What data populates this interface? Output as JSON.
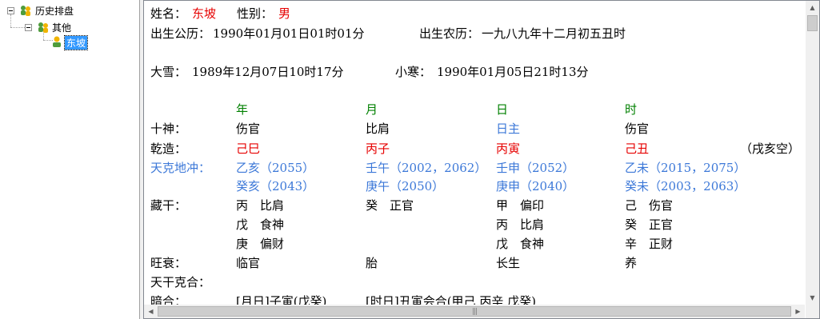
{
  "tree": {
    "root_label": "历史排盘",
    "group_label": "其他",
    "leaf_label": "东坡"
  },
  "profile": {
    "name_label": "姓名：",
    "name_value": "东坡",
    "gender_label": "性别：",
    "gender_value": "男",
    "solar_label": "出生公历：",
    "solar_value": "1990年01月01日01时01分",
    "lunar_label": "出生农历：",
    "lunar_value": "一九八九年十二月初五丑时",
    "term1_label": "大雪：",
    "term1_value": "1989年12月07日10时17分",
    "term2_label": "小寒：",
    "term2_value": "1990年01月05日21时13分"
  },
  "chart": {
    "columns": [
      "年",
      "月",
      "日",
      "时"
    ],
    "shishen_label": "十神：",
    "shishen": [
      "伤官",
      "比肩",
      "日主",
      "伤官"
    ],
    "qianzao_label": "乾造：",
    "qianzao": [
      "己巳",
      "丙子",
      "丙寅",
      "己丑"
    ],
    "kongwang": "（戌亥空）",
    "tiankedichong_label": "天克地冲：",
    "tkdc_row1": [
      "乙亥（2055）",
      "壬午（2002，2062）",
      "壬申（2052）",
      "乙未（2015，2075）"
    ],
    "tkdc_row2": [
      "癸亥（2043）",
      "庚午（2050）",
      "庚申（2040）",
      "癸未（2003，2063）"
    ],
    "canggan_label": "藏干：",
    "canggan": [
      [
        "丙　比肩",
        "戊　食神",
        "庚　偏财"
      ],
      [
        "癸　正官"
      ],
      [
        "甲　偏印",
        "丙　比肩",
        "戊　食神"
      ],
      [
        "己　伤官",
        "癸　正官",
        "辛　正财"
      ]
    ],
    "wangshuai_label": "旺衰：",
    "wangshuai": [
      "临官",
      "胎",
      "长生",
      "养"
    ],
    "tiangan_label": "天干克合：",
    "anhe_label": "暗合：",
    "anhe_values": [
      "[月日]子寅(戊癸)",
      "[时日]丑寅会合(甲己 丙辛 戊癸)"
    ]
  },
  "colors": {
    "name_red": "#e60000",
    "column_green": "#008000",
    "link_blue": "#3c78d8",
    "selection": "#3399ff"
  }
}
